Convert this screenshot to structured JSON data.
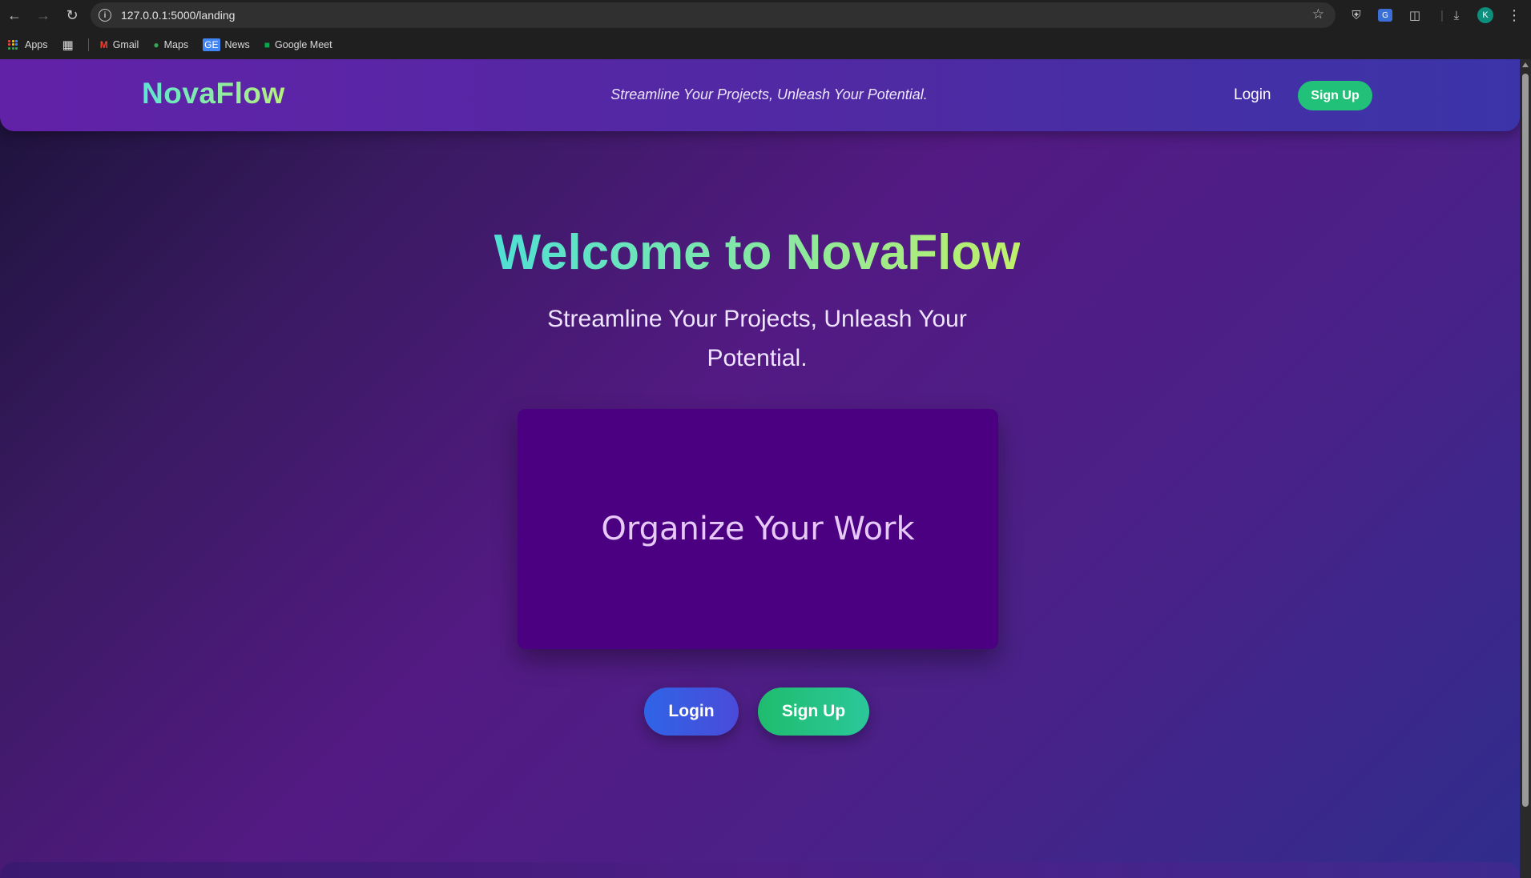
{
  "browser": {
    "url": "127.0.0.1:5000/landing",
    "avatar_letter": "K",
    "bookmarks": [
      {
        "label": "Apps",
        "icon": "apps-grid-icon"
      },
      {
        "label": "Gmail",
        "icon": "gmail-icon"
      },
      {
        "label": "Maps",
        "icon": "maps-pin-icon"
      },
      {
        "label": "News",
        "icon": "news-icon"
      },
      {
        "label": "Google Meet",
        "icon": "meet-icon"
      }
    ],
    "news_icon_text": "GE"
  },
  "header": {
    "logo": "NovaFlow",
    "tagline": "Streamline Your Projects, Unleash Your Potential.",
    "login_label": "Login",
    "signup_label": "Sign Up"
  },
  "hero": {
    "title": "Welcome to NovaFlow",
    "subtitle": "Streamline Your Projects, Unleash Your Potential.",
    "card_title": "Organize Your Work",
    "login_label": "Login",
    "signup_label": "Sign Up"
  },
  "colors": {
    "header_bg": "#6222a8",
    "signup_green": "#22c17a",
    "login_blue": "#2f64e6",
    "card_bg": "#4b0082",
    "logo_gradient_start": "#5ee6d0",
    "logo_gradient_end": "#b7f07c"
  }
}
